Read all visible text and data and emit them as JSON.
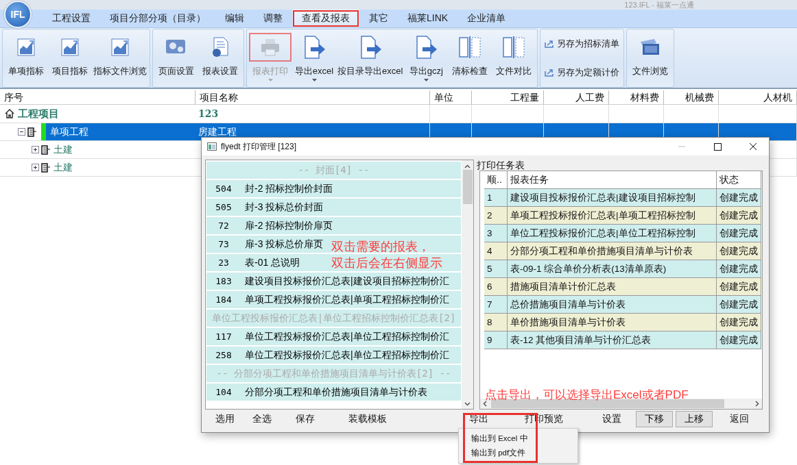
{
  "window": {
    "title": "123.IFL - 福莱一点通"
  },
  "logo": {
    "text": "IFL"
  },
  "menu_tabs": [
    {
      "label": "工程设置",
      "selected": false,
      "highlighted": false
    },
    {
      "label": "项目分部分项（目录）",
      "selected": false,
      "highlighted": false
    },
    {
      "label": "编辑",
      "selected": false,
      "highlighted": false
    },
    {
      "label": "调整",
      "selected": false,
      "highlighted": false
    },
    {
      "label": "查看及报表",
      "selected": true,
      "highlighted": true
    },
    {
      "label": "其它",
      "selected": false,
      "highlighted": false
    },
    {
      "label": "福莱LINK",
      "selected": false,
      "highlighted": false
    },
    {
      "label": "企业清单",
      "selected": false,
      "highlighted": false
    }
  ],
  "ribbon_groups": [
    {
      "items": [
        {
          "label": "单项指标",
          "kind": "chart",
          "disabled": false,
          "dropdown": false,
          "highlighted": false
        },
        {
          "label": "项目指标",
          "kind": "chart",
          "disabled": false,
          "dropdown": false,
          "highlighted": false
        },
        {
          "label": "指标文件浏览",
          "kind": "chart",
          "disabled": false,
          "dropdown": false,
          "highlighted": false
        }
      ]
    },
    {
      "items": [
        {
          "label": "页面设置",
          "kind": "gears",
          "disabled": false,
          "dropdown": false,
          "highlighted": false
        },
        {
          "label": "报表设置",
          "kind": "docgear",
          "disabled": false,
          "dropdown": false,
          "highlighted": false
        }
      ]
    },
    {
      "items": [
        {
          "label": "报表打印",
          "kind": "printer",
          "disabled": true,
          "dropdown": true,
          "highlighted": true
        },
        {
          "label": "导出excel",
          "kind": "export",
          "disabled": false,
          "dropdown": true,
          "highlighted": false
        },
        {
          "label": "按目录导出excel",
          "kind": "export",
          "disabled": false,
          "dropdown": false,
          "highlighted": false
        },
        {
          "label": "导出gczj",
          "kind": "export",
          "disabled": false,
          "dropdown": true,
          "highlighted": false
        },
        {
          "label": "清标检查",
          "kind": "compare",
          "disabled": false,
          "dropdown": false,
          "highlighted": false
        },
        {
          "label": "文件对比",
          "kind": "compare",
          "disabled": false,
          "dropdown": false,
          "highlighted": false
        }
      ]
    },
    {
      "items": [
        {
          "label": "另存为招标清单",
          "kind": "saveas",
          "disabled": false,
          "dropdown": false,
          "highlighted": false
        },
        {
          "label": "另存为定额计价",
          "kind": "saveas",
          "disabled": false,
          "dropdown": false,
          "highlighted": false
        }
      ]
    },
    {
      "items": [
        {
          "label": "文件浏览",
          "kind": "browse",
          "disabled": false,
          "dropdown": false,
          "highlighted": false
        }
      ]
    }
  ],
  "grid": {
    "columns": [
      "序号",
      "项目名称",
      "单位",
      "工程量",
      "人工费",
      "材料费",
      "机械费",
      "人材机"
    ],
    "rows": [
      {
        "label": "工程项目",
        "name": "123",
        "selected": false,
        "children": [
          {
            "label": "单项工程",
            "name": "房建工程",
            "selected": true,
            "expanded": true,
            "children": [
              {
                "label": "土建",
                "selected": false,
                "expanded": false
              },
              {
                "label": "土建",
                "selected": false,
                "expanded": false
              }
            ]
          }
        ]
      }
    ]
  },
  "dialog": {
    "title": "flyedt 打印管理 [123]",
    "report_list": [
      {
        "kind": "header",
        "text": "-- 封面[4] --"
      },
      {
        "kind": "report",
        "number": "504",
        "text": "封-2 招标控制价封面"
      },
      {
        "kind": "report",
        "number": "505",
        "text": "封-3 投标总价封面"
      },
      {
        "kind": "report",
        "number": "72",
        "text": "扉-2 招标控制价扉页"
      },
      {
        "kind": "report",
        "number": "73",
        "text": "扉-3 投标总价扉页"
      },
      {
        "kind": "report",
        "number": "23",
        "text": "表-01 总说明"
      },
      {
        "kind": "report",
        "number": "183",
        "text": "建设项目投标报价汇总表|建设项目招标控制价汇"
      },
      {
        "kind": "report",
        "number": "184",
        "text": "单项工程投标报价汇总表|单项工程招标控制价汇"
      },
      {
        "kind": "header",
        "text": "单位工程投标报价汇总表|单位工程招标控制价汇总表[2]"
      },
      {
        "kind": "report",
        "number": "117",
        "text": "单位工程投标报价汇总表|单位工程招标控制价汇"
      },
      {
        "kind": "report",
        "number": "258",
        "text": "单位工程投标报价汇总表|单位工程招标控制价汇"
      },
      {
        "kind": "header",
        "text": "-- 分部分项工程和单价措施项目清单与计价表[2] --"
      },
      {
        "kind": "report",
        "number": "104",
        "text": "分部分项工程和单价措施项目清单与计价表"
      }
    ],
    "task_table": {
      "title": "打印任务表",
      "columns": [
        "顺..",
        "报表任务",
        "状态"
      ],
      "rows": [
        {
          "order": "1",
          "task": "建设项目投标报价汇总表|建设项目招标控制",
          "status": "创建完成"
        },
        {
          "order": "2",
          "task": "单项工程投标报价汇总表|单项工程招标控制",
          "status": "创建完成"
        },
        {
          "order": "3",
          "task": "单位工程投标报价汇总表|单位工程招标控制",
          "status": "创建完成"
        },
        {
          "order": "4",
          "task": "分部分项工程和单价措施项目清单与计价表",
          "status": "创建完成"
        },
        {
          "order": "5",
          "task": "表-09-1 综合单价分析表(13清单原表)",
          "status": "创建完成"
        },
        {
          "order": "6",
          "task": "措施项目清单计价汇总表",
          "status": "创建完成"
        },
        {
          "order": "7",
          "task": "总价措施项目清单与计价表",
          "status": "创建完成"
        },
        {
          "order": "8",
          "task": "单价措施项目清单与计价表",
          "status": "创建完成"
        },
        {
          "order": "9",
          "task": "表-12 其他项目清单与计价汇总表",
          "status": "创建完成"
        }
      ]
    },
    "buttons": [
      {
        "label": "选用",
        "kind": "plain"
      },
      {
        "label": "全选",
        "kind": "plain"
      },
      {
        "label": "保存",
        "kind": "plain"
      },
      {
        "label": "装载模板",
        "kind": "plain"
      },
      {
        "label": "导出",
        "kind": "plain"
      },
      {
        "label": "打印预览",
        "kind": "plain"
      },
      {
        "label": "设置",
        "kind": "plain"
      },
      {
        "label": "下移",
        "kind": "framed"
      },
      {
        "label": "上移",
        "kind": "framed"
      },
      {
        "label": "返回",
        "kind": "plain"
      }
    ]
  },
  "export_menu": {
    "highlighted": true,
    "items": [
      "输出到 Excel 中",
      "输出到 pdf文件"
    ]
  },
  "notes": [
    {
      "lines": [
        "双击需要的报表，",
        "双击后会在右侧显示"
      ],
      "kind": "list"
    },
    {
      "lines": [
        "点击导出，可以选择导出Excel或者PDF"
      ],
      "kind": "table"
    }
  ]
}
